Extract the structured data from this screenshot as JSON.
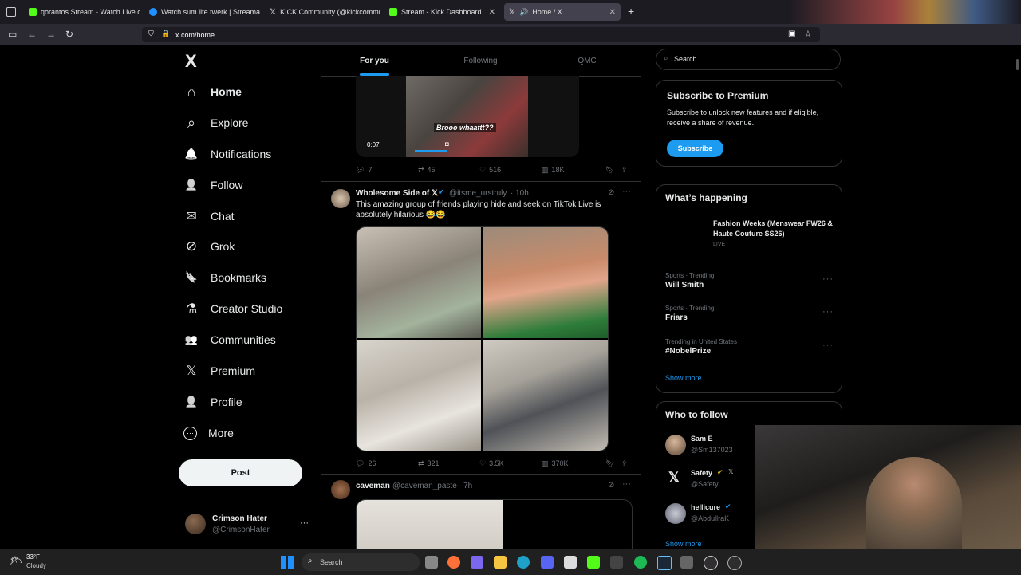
{
  "browser": {
    "tabs": [
      {
        "label": "qorantos Stream - Watch Live o",
        "favicon_color": "#53fc18"
      },
      {
        "label": "Watch sum lite twerk | Streama",
        "favicon_color": "#1e90ff"
      },
      {
        "label": "KICK Community (@kickcommu",
        "favicon_color": "#e7e9ea"
      },
      {
        "label": "Stream - Kick Dashboard",
        "favicon_color": "#53fc18"
      },
      {
        "label": "Home / X",
        "favicon_color": "#e7e9ea"
      }
    ],
    "url": "x.com/home",
    "new_tab_label": "+"
  },
  "sidebar": {
    "logo": "X",
    "items": [
      {
        "label": "Home",
        "icon": "home-icon",
        "glyph": "⌂"
      },
      {
        "label": "Explore",
        "icon": "search-icon",
        "glyph": "⌕"
      },
      {
        "label": "Notifications",
        "icon": "bell-icon",
        "glyph": "🔔"
      },
      {
        "label": "Follow",
        "icon": "person-plus-icon",
        "glyph": "👤"
      },
      {
        "label": "Chat",
        "icon": "mail-icon",
        "glyph": "✉"
      },
      {
        "label": "Grok",
        "icon": "grok-icon",
        "glyph": "⊘"
      },
      {
        "label": "Bookmarks",
        "icon": "bookmark-icon",
        "glyph": "🔖"
      },
      {
        "label": "Creator Studio",
        "icon": "flask-icon",
        "glyph": "⚗"
      },
      {
        "label": "Communities",
        "icon": "people-icon",
        "glyph": "👥"
      },
      {
        "label": "Premium",
        "icon": "x-icon",
        "glyph": "𝕏"
      },
      {
        "label": "Profile",
        "icon": "person-icon",
        "glyph": "👤"
      },
      {
        "label": "More",
        "icon": "more-circle-icon",
        "glyph": "⋯"
      }
    ],
    "post_label": "Post",
    "account": {
      "name": "Crimson Hater",
      "handle": "@CrimsonHater",
      "more": "···"
    }
  },
  "feed": {
    "tabs": [
      "For you",
      "Following",
      "QMC"
    ],
    "post1": {
      "video_time": "0:07",
      "caption": "Brooo whaattt??",
      "replies": "7",
      "reposts": "45",
      "likes": "516",
      "views": "18K"
    },
    "post2": {
      "author": "Wholesome Side of 𝕏",
      "handle": "@itsme_urstruly",
      "time": "· 10h",
      "text": "This amazing group of friends playing hide and seek on TikTok Live is absolutely hilarious 😂😂",
      "replies": "26",
      "reposts": "321",
      "likes": "3.5K",
      "views": "370K"
    },
    "post3": {
      "author": "caveman",
      "handle": "@caveman_paste",
      "time": "· 7h"
    }
  },
  "right": {
    "search_placeholder": "Search",
    "premium": {
      "title": "Subscribe to Premium",
      "text": "Subscribe to unlock new features and if eligible, receive a share of revenue.",
      "button": "Subscribe"
    },
    "happening": {
      "title": "What’s happening",
      "feature": {
        "name": "Fashion Weeks (Menswear FW26 & Haute Couture SS26)",
        "status": "LIVE"
      },
      "trends": [
        {
          "meta": "Sports · Trending",
          "name": "Will Smith"
        },
        {
          "meta": "Sports · Trending",
          "name": "Friars"
        },
        {
          "meta": "Trending in United States",
          "name": "#NobelPrize"
        }
      ],
      "show_more": "Show more"
    },
    "who_to_follow": {
      "title": "Who to follow",
      "users": [
        {
          "name": "Sam E",
          "handle": "@Sm137023"
        },
        {
          "name": "Safety",
          "handle": "@Safety"
        },
        {
          "name": "hellicure",
          "handle": "@AbdullraK"
        }
      ],
      "show_more": "Show more"
    }
  },
  "taskbar": {
    "weather_temp": "33°F",
    "weather_desc": "Cloudy",
    "search_label": "Search"
  },
  "colors": {
    "accent": "#1d9bf0",
    "background": "#000000",
    "border": "#2f3336"
  }
}
